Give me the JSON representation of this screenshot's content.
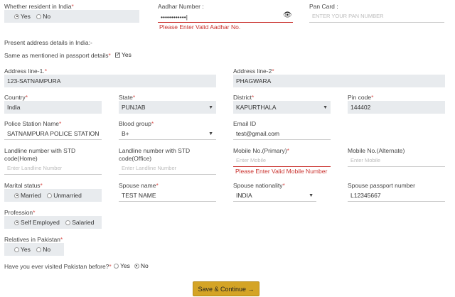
{
  "residency": {
    "label": "Whether resident in India",
    "options": [
      "Yes",
      "No"
    ],
    "selected": "Yes"
  },
  "aadhar": {
    "label": "Aadhar Number :",
    "value": "••••••••••••|",
    "error": "Please Enter Valid Aadhar No."
  },
  "pan": {
    "label": "Pan Card :",
    "placeholder": "ENTER YOUR PAN NUMBER"
  },
  "present_heading": "Present address details in India:-",
  "same_as_passport": {
    "label": "Same as mentioned in passport details",
    "checkbox_label": "Yes",
    "checked": true
  },
  "address1": {
    "label": "Address line-1.",
    "value": "123-SATNAMPURA"
  },
  "address2": {
    "label": "Address line-2",
    "value": "PHAGWARA"
  },
  "country": {
    "label": "Country",
    "value": "India"
  },
  "state": {
    "label": "State",
    "value": "PUNJAB"
  },
  "district": {
    "label": "District",
    "value": "KAPURTHALA"
  },
  "pincode": {
    "label": "Pin code",
    "value": "144402"
  },
  "police": {
    "label": "Police Station Name",
    "value": "SATNAMPURA POLICE STATION"
  },
  "blood": {
    "label": "Blood group",
    "value": "B+"
  },
  "email": {
    "label": "Email ID",
    "value": "test@gmail.com"
  },
  "landline_home": {
    "label1": "Landline number with STD",
    "label2": "code(Home)",
    "placeholder": "Enter Landline Number"
  },
  "landline_office": {
    "label1": "Landline number with STD",
    "label2": "code(Office)",
    "placeholder": "Enter Landline Number"
  },
  "mobile_primary": {
    "label": "Mobile No.(Primary)",
    "placeholder": "Enter Mobile",
    "error": "Please Enter Valid Mobile Number"
  },
  "mobile_alt": {
    "label": "Mobile No.(Alternate)",
    "placeholder": "Enter Mobile"
  },
  "marital": {
    "label": "Marital status",
    "options": [
      "Married",
      "Unmarried"
    ],
    "selected": "Married"
  },
  "spouse_name": {
    "label": "Spouse name",
    "value": "TEST NAME"
  },
  "spouse_nationality": {
    "label": "Spouse nationality",
    "value": "INDIA"
  },
  "spouse_passport": {
    "label": "Spouse passport number",
    "value": "L12345667"
  },
  "profession": {
    "label": "Profession",
    "options": [
      "Self Employed",
      "Salaried"
    ],
    "selected": "Self Employed"
  },
  "relatives": {
    "label": "Relatives in Pakistan",
    "options": [
      "Yes",
      "No"
    ]
  },
  "visited": {
    "label": "Have you ever visited Pakistan before?",
    "options": [
      "Yes",
      "No"
    ],
    "selected": "No"
  },
  "submit": {
    "label": "Save & Continue →"
  },
  "colors": {
    "error": "#c9302c",
    "button": "#d4a426",
    "field_bg": "#e8ebee"
  }
}
